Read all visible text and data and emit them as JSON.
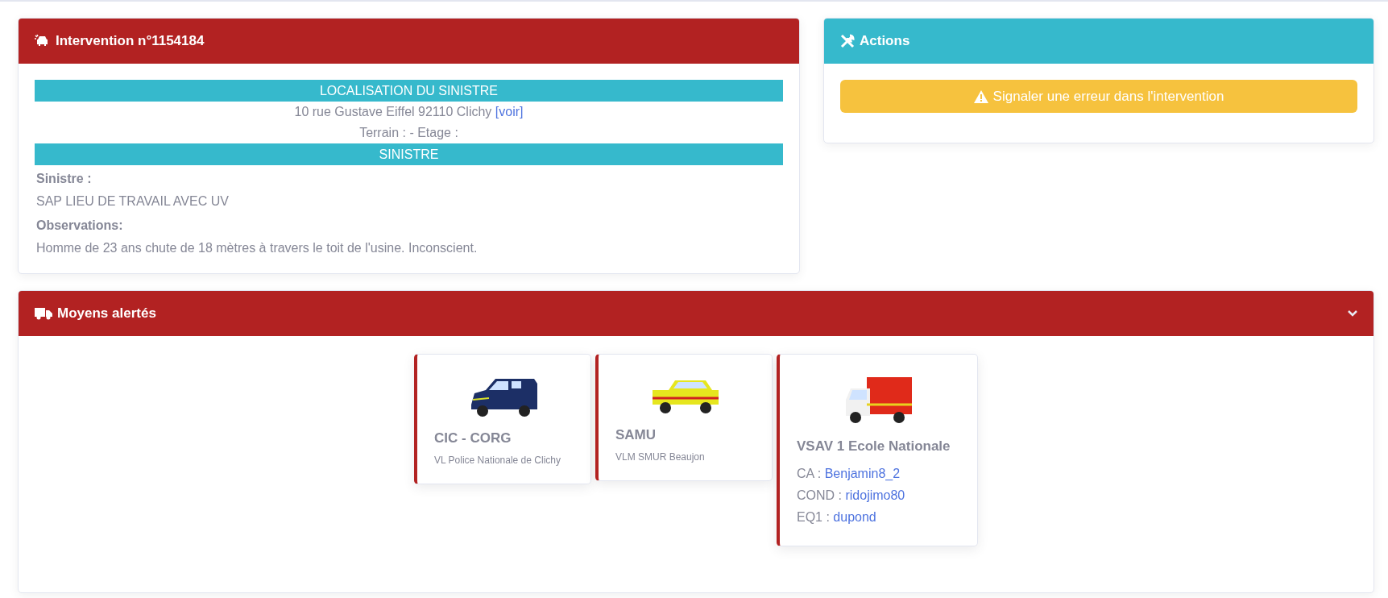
{
  "intervention": {
    "title": "Intervention n°1154184",
    "location_heading": "LOCALISATION DU SINISTRE",
    "address": "10 rue Gustave Eiffel 92110 Clichy",
    "map_link": "[voir]",
    "terrain": "Terrain : - Etage :",
    "sinistre_heading": "SINISTRE",
    "fields": [
      {
        "label": "Sinistre :",
        "value": "SAP LIEU DE TRAVAIL AVEC UV"
      },
      {
        "label": "Observations:",
        "value": "Homme de 23 ans chute de 18 mètres à travers le toit de l'usine. Inconscient."
      }
    ]
  },
  "actions": {
    "title": "Actions",
    "button": "Signaler une erreur dans l'intervention"
  },
  "units": {
    "title": "Moyens alertés",
    "expanded": true,
    "cards": [
      {
        "kind": "van",
        "name": "CIC - CORG",
        "subtitle": "VL Police Nationale de Clichy"
      },
      {
        "kind": "suv",
        "name": "SAMU",
        "subtitle": "VLM SMUR Beaujon"
      },
      {
        "kind": "ambulance",
        "name": "VSAV 1 Ecole Nationale",
        "crew": [
          {
            "role": "CA :",
            "member": "Benjamin8_2"
          },
          {
            "role": "COND :",
            "member": "ridojimo80"
          },
          {
            "role": "EQ1 :",
            "member": "dupond"
          }
        ]
      }
    ]
  }
}
